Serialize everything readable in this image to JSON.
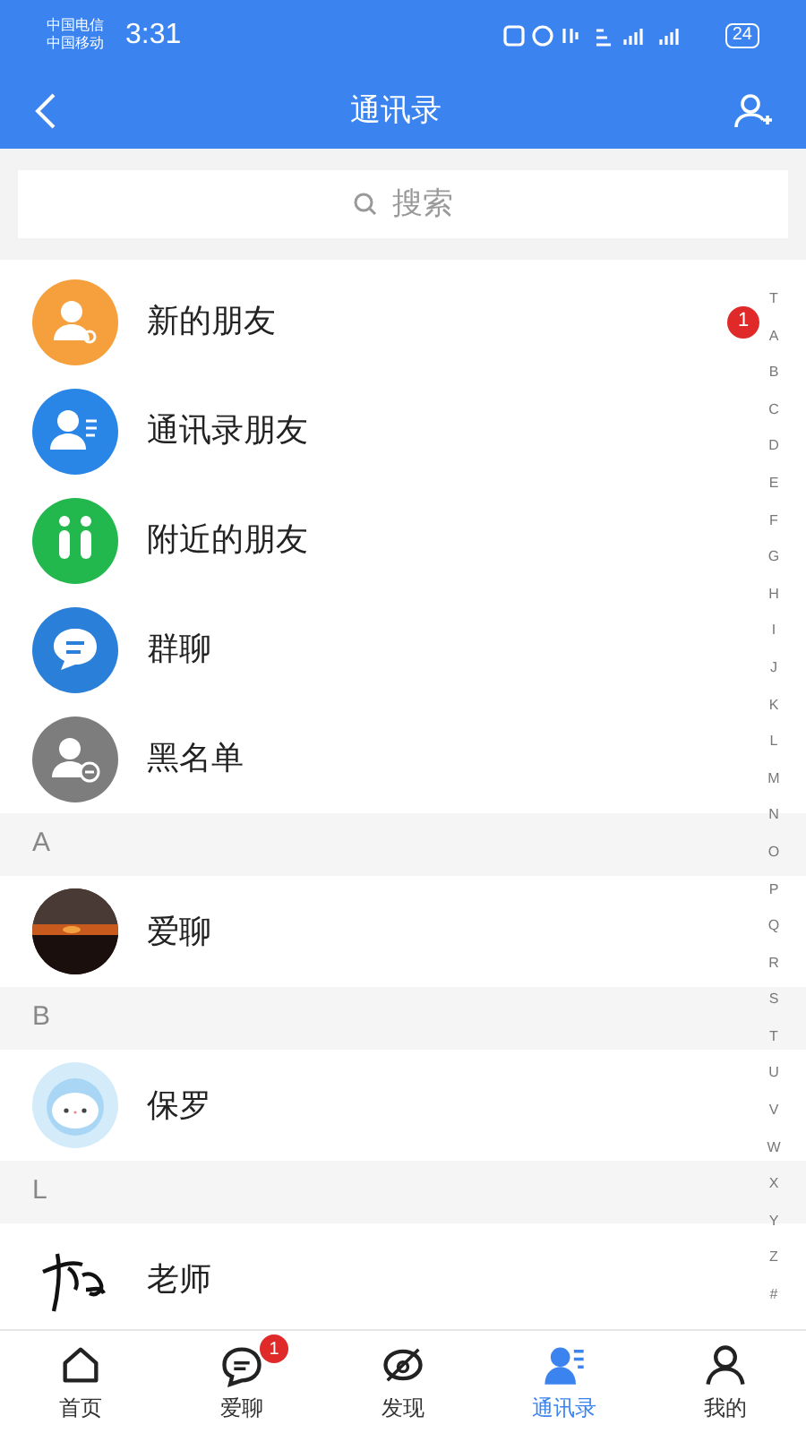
{
  "status_bar": {
    "carriers": [
      "中国电信",
      "中国移动"
    ],
    "time": "3:31",
    "battery": "24"
  },
  "header": {
    "title": "通讯录"
  },
  "search": {
    "placeholder": "搜索"
  },
  "entries": [
    {
      "kind": "new",
      "label": "新的朋友",
      "badge": "1"
    },
    {
      "kind": "phone",
      "label": "通讯录朋友"
    },
    {
      "kind": "nearby",
      "label": "附近的朋友"
    },
    {
      "kind": "group",
      "label": "群聊"
    },
    {
      "kind": "block",
      "label": "黑名单"
    }
  ],
  "sections": [
    {
      "letter": "A",
      "contacts": [
        {
          "name": "爱聊"
        }
      ]
    },
    {
      "letter": "B",
      "contacts": [
        {
          "name": "保罗"
        }
      ]
    },
    {
      "letter": "L",
      "contacts": [
        {
          "name": "老师"
        }
      ]
    }
  ],
  "index_letters": [
    "T",
    "A",
    "B",
    "C",
    "D",
    "E",
    "F",
    "G",
    "H",
    "I",
    "J",
    "K",
    "L",
    "M",
    "N",
    "O",
    "P",
    "Q",
    "R",
    "S",
    "T",
    "U",
    "V",
    "W",
    "X",
    "Y",
    "Z",
    "#"
  ],
  "tabs": [
    {
      "label": "首页",
      "selected": false
    },
    {
      "label": "爱聊",
      "selected": false,
      "badge": "1"
    },
    {
      "label": "发现",
      "selected": false
    },
    {
      "label": "通讯录",
      "selected": true
    },
    {
      "label": "我的",
      "selected": false
    }
  ]
}
